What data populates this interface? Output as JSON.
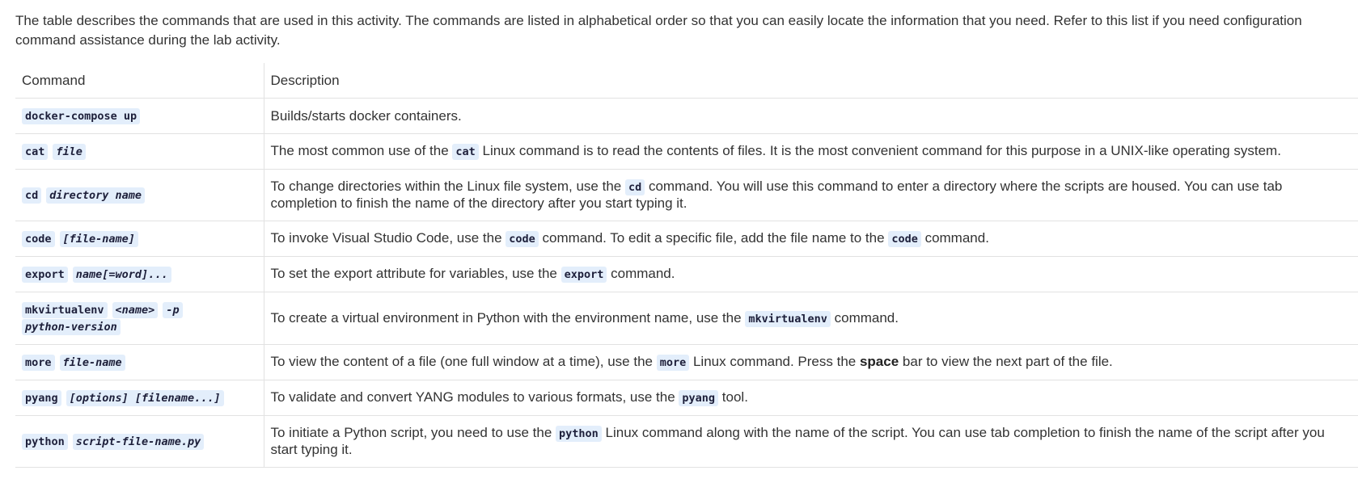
{
  "intro": "The table describes the commands that are used in this activity. The commands are listed in alphabetical order so that you can easily locate the information that you need. Refer to this list if you need configuration command assistance during the lab activity.",
  "table": {
    "headers": {
      "command": "Command",
      "description": "Description"
    },
    "rows": [
      {
        "cmd": "docker-compose up",
        "desc": "Builds/starts docker containers."
      },
      {
        "cmd": "cat",
        "arg": "file",
        "desc_pre": "The most common use of the",
        "desc_code": "cat",
        "desc_post": "Linux command is to read the contents of files. It is the most convenient command for this purpose in a UNIX-like operating system."
      },
      {
        "cmd": "cd",
        "arg": "directory name",
        "desc_pre": "To change directories within the Linux file system, use the",
        "desc_code": "cd",
        "desc_post": "command. You will use this command to enter a directory where the scripts are housed. You can use tab completion to finish the name of the directory after you start typing it."
      },
      {
        "cmd": "code",
        "arg": "[file-name]",
        "desc_pre": "To invoke Visual Studio Code, use the",
        "desc_code": "code",
        "desc_mid": "command. To edit a specific file, add the file name to the",
        "desc_code2": "code",
        "desc_post": "command."
      },
      {
        "cmd": "export",
        "arg": "name[=word]...",
        "desc_pre": "To set the export attribute for variables, use the",
        "desc_code": "export",
        "desc_post": "command."
      },
      {
        "cmd": "mkvirtualenv",
        "arg": "<name>",
        "arg2": "-p",
        "arg3": "python-version",
        "desc_pre": "To create a virtual environment in Python with the environment name, use the",
        "desc_code": "mkvirtualenv",
        "desc_post": "command."
      },
      {
        "cmd": "more",
        "arg": "file-name",
        "desc_pre": "To view the content of a file (one full window at a time), use the",
        "desc_code": "more",
        "desc_mid": "Linux command. Press the",
        "desc_bold": "space",
        "desc_post": "bar to view the next part of the file."
      },
      {
        "cmd": "pyang",
        "arg": "[options] [filename...]",
        "desc_pre": "To validate and convert YANG modules to various formats, use the",
        "desc_code": "pyang",
        "desc_post": "tool."
      },
      {
        "cmd": "python",
        "arg": "script-file-name.py",
        "desc_pre": "To initiate a Python script, you need to use the",
        "desc_code": "python",
        "desc_post": "Linux command along with the name of the script. You can use tab completion to finish the name of the script after you start typing it."
      }
    ]
  }
}
